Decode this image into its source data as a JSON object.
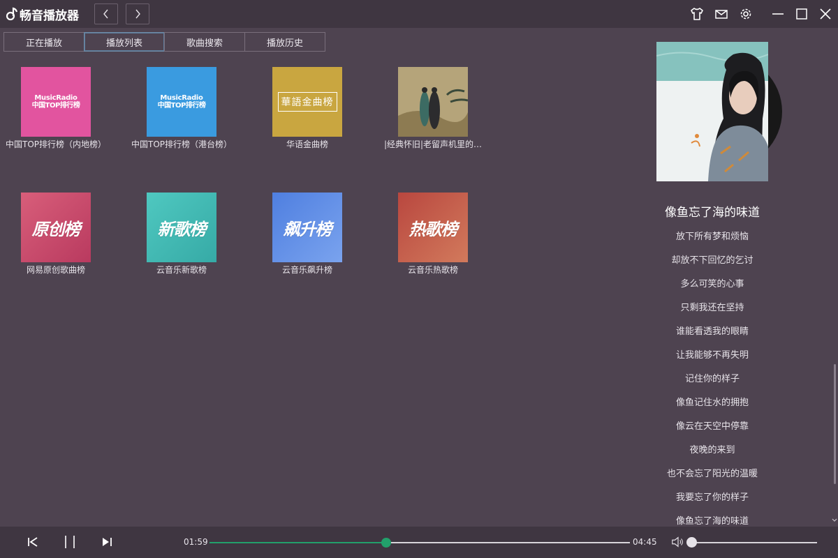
{
  "app": {
    "title": "畅音播放器"
  },
  "tabs": [
    {
      "label": "正在播放",
      "active": false
    },
    {
      "label": "播放列表",
      "active": true
    },
    {
      "label": "歌曲搜索",
      "active": false
    },
    {
      "label": "播放历史",
      "active": false
    }
  ],
  "playlists": [
    {
      "label": "中国TOP排行榜（内地榜）",
      "cover_line1": "MusicRadio",
      "cover_line2": "中国TOP排行榜",
      "cover_color": "#e2549f"
    },
    {
      "label": "中国TOP排行榜（港台榜）",
      "cover_line1": "MusicRadio",
      "cover_line2": "中国TOP排行榜",
      "cover_color": "#3a9be0"
    },
    {
      "label": "华语金曲榜",
      "cover_text": "華語金曲榜",
      "cover_color": "#c9a640"
    },
    {
      "label": "|经典怀旧|老留声机里的…",
      "cover_color": "#a89b6e"
    },
    {
      "label": "网易原创歌曲榜",
      "cover_text": "原创榜",
      "cover_color": "#c9456a"
    },
    {
      "label": "云音乐新歌榜",
      "cover_text": "新歌榜",
      "cover_color": "#3fbcb4"
    },
    {
      "label": "云音乐飙升榜",
      "cover_text": "飙升榜",
      "cover_color": "#5b8fe0"
    },
    {
      "label": "云音乐热歌榜",
      "cover_text": "热歌榜",
      "cover_color": "#c25a4a"
    }
  ],
  "now_playing": {
    "title": "像鱼忘了海的味道",
    "lyrics": [
      "放下所有梦和烦恼",
      "却放不下回忆的乞讨",
      "多么可笑的心事",
      "只剩我还在坚持",
      "谁能看透我的眼睛",
      "让我能够不再失明",
      "记住你的样子",
      "像鱼记住水的拥抱",
      "像云在天空中停靠",
      "夜晚的来到",
      "也不会忘了阳光的温暖",
      "我要忘了你的样子",
      "像鱼忘了海的味道"
    ],
    "current_time": "01:59",
    "total_time": "04:45",
    "progress": 0.42,
    "volume": 0.0
  },
  "colors": {
    "accent": "#22a06b"
  },
  "icons": [
    "music-note-icon",
    "prev-nav-icon",
    "next-nav-icon",
    "skin-icon",
    "mail-icon",
    "settings-icon",
    "minimize-icon",
    "maximize-icon",
    "close-icon",
    "prev-track-icon",
    "pause-icon",
    "next-track-icon",
    "volume-icon",
    "scroll-down-icon"
  ]
}
